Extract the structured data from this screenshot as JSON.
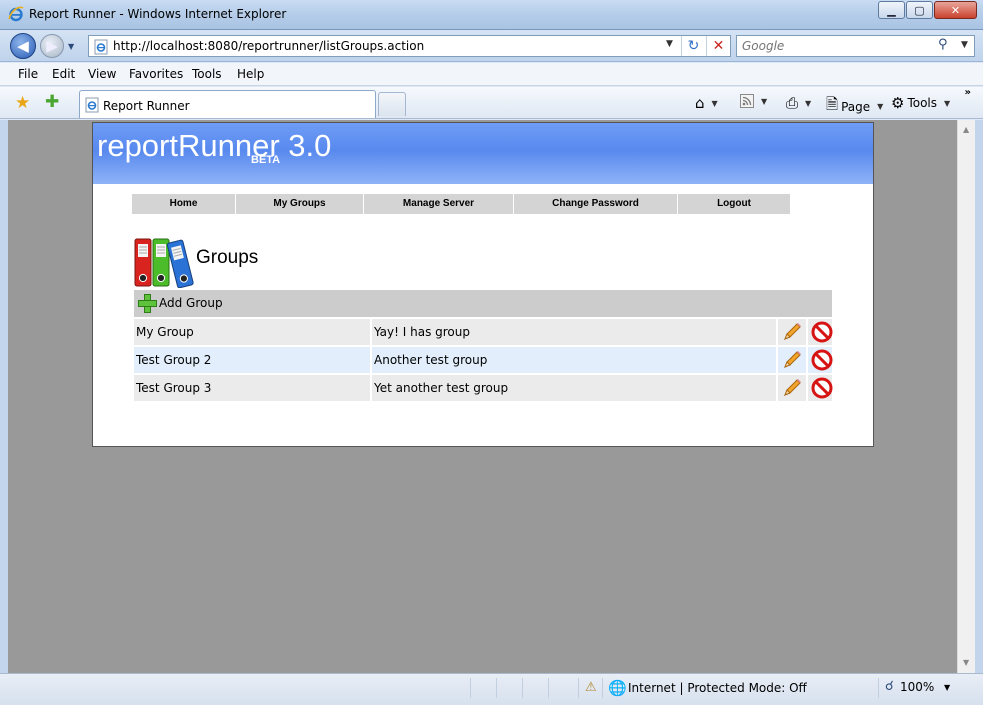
{
  "window": {
    "title": "Report Runner - Windows Internet Explorer",
    "buttons": {
      "minimize": "▁",
      "maximize": "▢",
      "close": "✕"
    }
  },
  "address": {
    "url": "http://localhost:8080/reportrunner/listGroups.action",
    "refresh_symbol": "↻",
    "stop_symbol": "✕"
  },
  "search": {
    "placeholder": "Google",
    "symbol": "⚲"
  },
  "menu": [
    "File",
    "Edit",
    "View",
    "Favorites",
    "Tools",
    "Help"
  ],
  "tab": {
    "label": "Report Runner"
  },
  "commands": {
    "page": "Page",
    "tools": "Tools",
    "more": "»"
  },
  "site": {
    "brand": "reportRunner 3.0",
    "beta": "BETA",
    "nav": [
      "Home",
      "My Groups",
      "Manage Server",
      "Change Password",
      "Logout"
    ],
    "heading": "Groups",
    "add_label": "Add Group",
    "rows": [
      {
        "name": "My Group",
        "description": "Yay! I has group"
      },
      {
        "name": "Test Group 2",
        "description": "Another test group"
      },
      {
        "name": "Test Group 3",
        "description": "Yet another test group"
      }
    ]
  },
  "status": {
    "zone": "Internet | Protected Mode: Off",
    "zoom": "100%"
  },
  "colors": {
    "banner": "#5889ee",
    "row": "#ebebeb",
    "row_alt": "#e2eefc",
    "viewport": "#999999"
  },
  "icons": {
    "ie": "ie-logo-icon",
    "back": "back-arrow-icon",
    "forward": "forward-arrow-icon",
    "favorites": "star-icon",
    "add_favorite": "add-favorite-icon",
    "home": "home-icon",
    "feeds": "rss-icon",
    "print": "printer-icon",
    "page": "page-icon",
    "tools": "gear-icon",
    "groups": "binders-icon",
    "add": "plus-icon",
    "edit": "pencil-icon",
    "delete": "no-sign-icon",
    "zone": "globe-icon",
    "zoom": "magnifier-icon"
  }
}
